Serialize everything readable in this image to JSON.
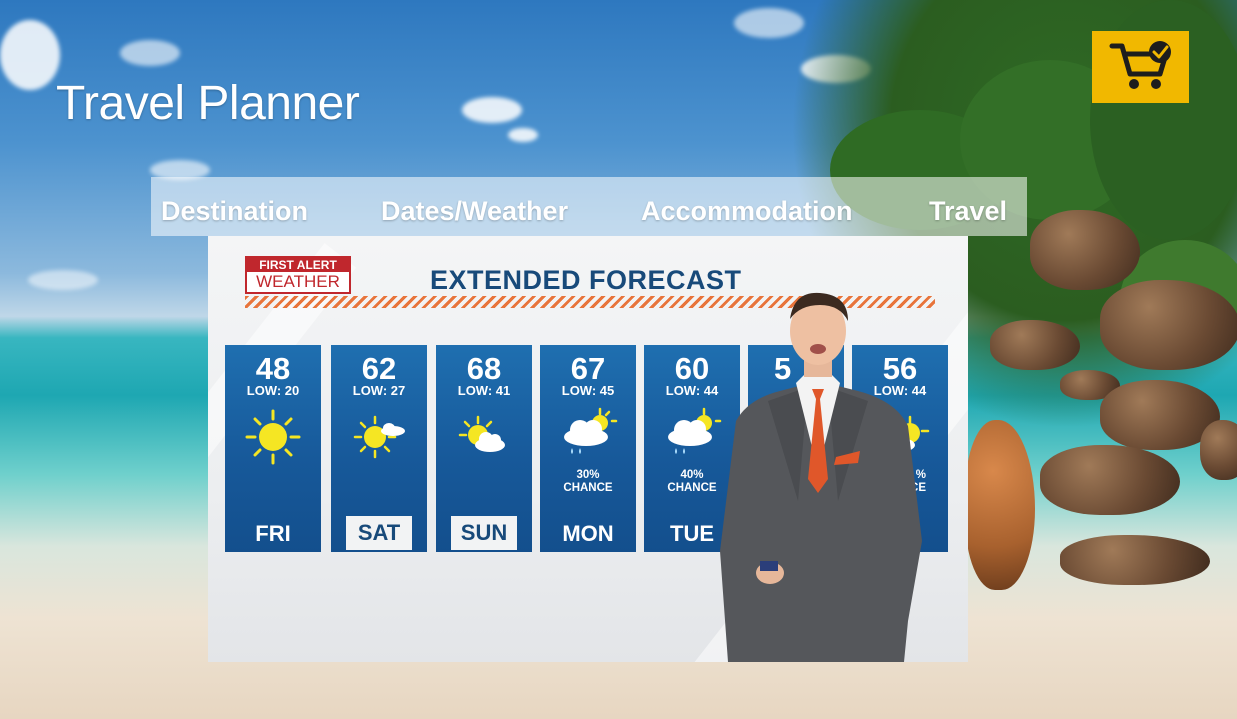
{
  "app": {
    "title": "Travel Planner"
  },
  "cart": {
    "icon": "shopping-cart-check-icon",
    "color": "#f1b800"
  },
  "nav": {
    "items": [
      {
        "label": "Destination"
      },
      {
        "label": "Dates/Weather"
      },
      {
        "label": "Accommodation"
      },
      {
        "label": "Travel"
      }
    ]
  },
  "weather": {
    "logo": {
      "line1": "FIRST ALERT",
      "line2": "WEATHER"
    },
    "title": "EXTENDED FORECAST",
    "days": [
      {
        "hi": "48",
        "lo": "LOW: 20",
        "icon": "sun-icon",
        "chance": "",
        "name": "FRI"
      },
      {
        "hi": "62",
        "lo": "LOW: 27",
        "icon": "sun-small-cloud-icon",
        "chance": "",
        "name": "SAT"
      },
      {
        "hi": "68",
        "lo": "LOW: 41",
        "icon": "partly-cloudy-icon",
        "chance": "",
        "name": "SUN"
      },
      {
        "hi": "67",
        "lo": "LOW: 45",
        "icon": "rain-sun-icon",
        "chance": "30%\nCHANCE",
        "name": "MON"
      },
      {
        "hi": "60",
        "lo": "LOW: 44",
        "icon": "rain-sun-icon",
        "chance": "40%\nCHANCE",
        "name": "TUE"
      },
      {
        "hi": "5",
        "lo": "",
        "icon": "",
        "chance": "",
        "name": ""
      },
      {
        "hi": "56",
        "lo": "LOW: 44",
        "icon": "partly-cloudy-icon",
        "chance": "%\nCE",
        "name": "U"
      }
    ]
  }
}
